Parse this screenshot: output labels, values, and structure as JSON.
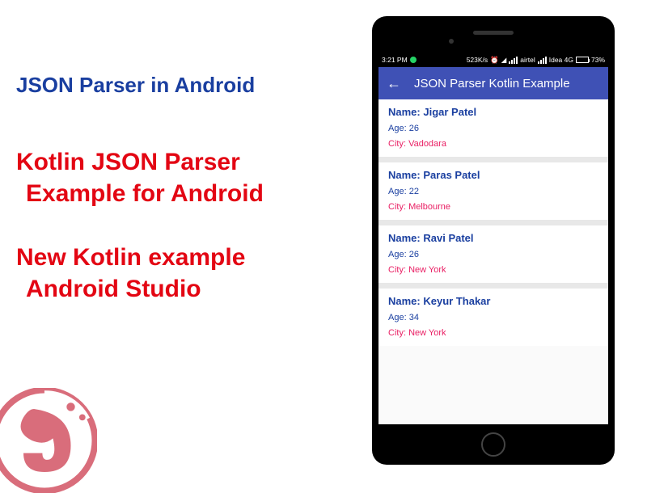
{
  "left": {
    "heading": "JSON Parser in Android",
    "line1": "Kotlin JSON Parser",
    "line2": "Example for Android",
    "line3": "New Kotlin example",
    "line4": "Android Studio"
  },
  "status": {
    "time": "3:21 PM",
    "speed": "523K/s",
    "carrier1": "airtel",
    "carrier2": "Idea 4G",
    "battery_pct": "73%",
    "battery_fill": 73
  },
  "appbar": {
    "title": "JSON Parser Kotlin Example"
  },
  "labels": {
    "name": "Name:",
    "age": "Age:",
    "city": "City:"
  },
  "people": [
    {
      "name": "Jigar Patel",
      "age": "26",
      "city": "Vadodara"
    },
    {
      "name": "Paras Patel",
      "age": "22",
      "city": "Melbourne"
    },
    {
      "name": "Ravi Patel",
      "age": "26",
      "city": "New York"
    },
    {
      "name": "Keyur Thakar",
      "age": "34",
      "city": "New York"
    }
  ]
}
